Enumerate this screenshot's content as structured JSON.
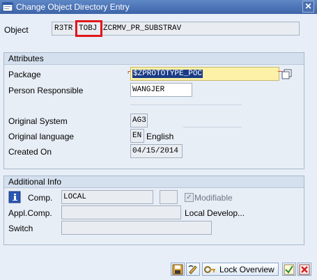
{
  "window": {
    "title": "Change Object Directory Entry",
    "close_glyph": "✕"
  },
  "object": {
    "label": "Object",
    "program_id": "R3TR",
    "object_type": "TOBJ",
    "object_name": "ZCRMV_PR_SUBSTRAV"
  },
  "attributes": {
    "title": "Attributes",
    "package_label": "Package",
    "package_value": "$ZPROTOTYPE_POC",
    "person_label": "Person Responsible",
    "person_value": "WANGJER",
    "orig_system_label": "Original System",
    "orig_system_value": "AG3",
    "orig_language_label": "Original language",
    "orig_language_value": "EN",
    "orig_language_text": "English",
    "created_label": "Created On",
    "created_value": "04/15/2014"
  },
  "additional": {
    "title": "Additional Info",
    "comp_label": "Comp.",
    "comp_value": "LOCAL",
    "modifiable_label": "Modifiable",
    "appl_comp_label": "Appl.Comp.",
    "appl_comp_text": "Local Develop...",
    "switch_label": "Switch"
  },
  "toolbar": {
    "lock_overview_label": "Lock Overview"
  },
  "icons": {
    "app": "sap-window-icon",
    "info": "info-icon",
    "save": "save-icon",
    "edit": "edit-icon",
    "lock": "lock-icon",
    "check": "check-icon",
    "cancel": "cancel-icon"
  },
  "colors": {
    "title_bar": "#3d64a8",
    "highlight_box": "#e0161b",
    "required_field": "#fdf1a8",
    "selection": "#1a3b86"
  }
}
